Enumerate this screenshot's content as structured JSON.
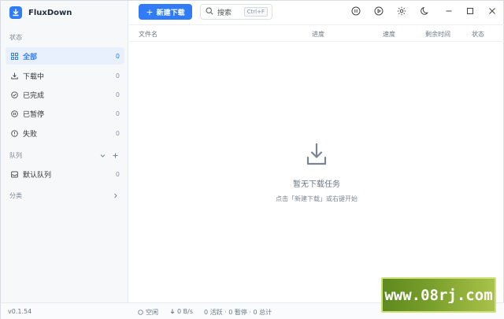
{
  "app": {
    "name": "FluxDown",
    "version": "v0.1.54"
  },
  "sidebar": {
    "status_label": "状态",
    "items": [
      {
        "label": "全部",
        "count": "0",
        "icon": "grid-icon"
      },
      {
        "label": "下载中",
        "count": "0",
        "icon": "download-icon"
      },
      {
        "label": "已完成",
        "count": "0",
        "icon": "check-circle-icon"
      },
      {
        "label": "已暂停",
        "count": "0",
        "icon": "pause-circle-icon"
      },
      {
        "label": "失败",
        "count": "0",
        "icon": "alert-circle-icon"
      }
    ],
    "queue_label": "队列",
    "queues": [
      {
        "label": "默认队列",
        "count": "0",
        "icon": "inbox-icon"
      }
    ],
    "category_label": "分类"
  },
  "toolbar": {
    "new_download": "新建下载",
    "search_label": "搜索",
    "search_shortcut": "Ctrl+F",
    "icons": [
      "pause-all-icon",
      "start-all-icon",
      "settings-icon",
      "theme-moon-icon",
      "minimize-icon",
      "maximize-icon",
      "close-icon"
    ]
  },
  "table": {
    "columns": [
      "文件名",
      "进度",
      "速度",
      "剩余时间",
      "状态"
    ]
  },
  "empty_state": {
    "title": "暂无下载任务",
    "subtitle": "点击「新建下载」或右键开始"
  },
  "statusbar": {
    "idle": "空闲",
    "speed": "0 B/s",
    "summary": "0 活跃 · 0 暂停 · 0 总计"
  },
  "watermark": {
    "text": "www.08rj.com"
  },
  "colors": {
    "accent": "#2f7cf6",
    "sidebar_bg": "#f6f8fa",
    "watermark_green": "#7aa02c"
  }
}
